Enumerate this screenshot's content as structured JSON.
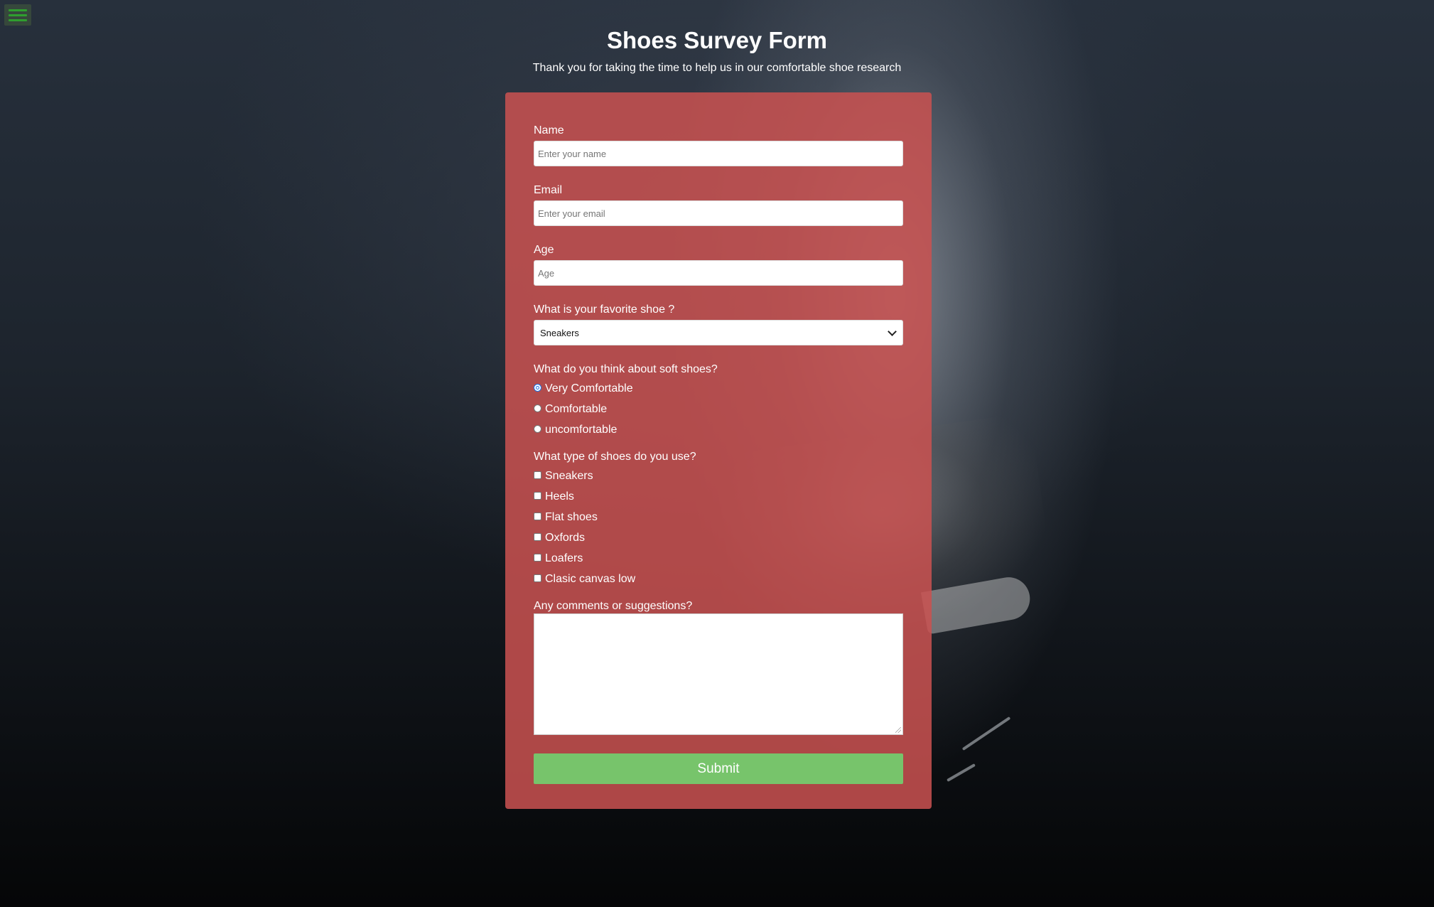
{
  "header": {
    "title": "Shoes Survey Form",
    "description": "Thank you for taking the time to help us in our comfortable shoe research"
  },
  "menu": {
    "icon": "hamburger-menu-icon",
    "color": "#2f9e2f"
  },
  "form": {
    "name": {
      "label": "Name",
      "placeholder": "Enter your name",
      "value": ""
    },
    "email": {
      "label": "Email",
      "placeholder": "Enter your email",
      "value": ""
    },
    "age": {
      "label": "Age",
      "placeholder": "Age",
      "value": ""
    },
    "favorite": {
      "label": "What is your favorite shoe ?",
      "selected": "Sneakers"
    },
    "soft": {
      "label": "What do you think about soft shoes?",
      "options": [
        "Very Comfortable",
        "Comfortable",
        "uncomfortable"
      ],
      "selected": "Very Comfortable"
    },
    "types": {
      "label": "What type of shoes do you use?",
      "options": [
        "Sneakers",
        "Heels",
        "Flat shoes",
        "Oxfords",
        "Loafers",
        "Clasic canvas low"
      ]
    },
    "comments": {
      "label": "Any comments or suggestions?",
      "value": ""
    },
    "submit_label": "Submit"
  },
  "colors": {
    "card": "#c95250",
    "submit": "#77c46b",
    "text": "#ffffff"
  }
}
